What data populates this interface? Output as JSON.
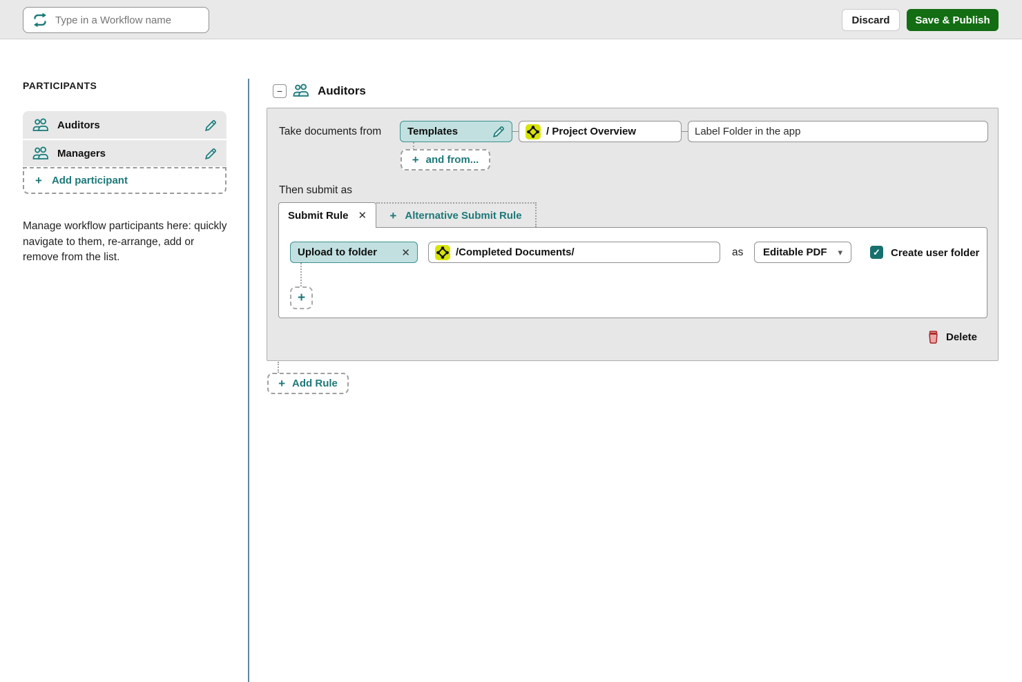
{
  "topbar": {
    "workflow_name_placeholder": "Type in a Workflow name",
    "discard_label": "Discard",
    "save_publish_label": "Save & Publish"
  },
  "sidebar": {
    "heading": "PARTICIPANTS",
    "participants": [
      {
        "label": "Auditors"
      },
      {
        "label": "Managers"
      }
    ],
    "add_participant_label": "Add participant",
    "description": "Manage workflow participants here: quickly navigate to them, re-arrange, add or remove from the list."
  },
  "main": {
    "section_title": "Auditors",
    "take_documents_from_label": "Take documents from",
    "source_chip_label": "Templates",
    "source_folder_path": "/ Project Overview",
    "folder_label_value": "Label Folder in the app",
    "and_from_label": "and from...",
    "then_submit_as_label": "Then submit as",
    "tabs": {
      "active_tab_label": "Submit Rule",
      "alternative_tab_label": "Alternative Submit Rule"
    },
    "rule": {
      "action_chip_label": "Upload to folder",
      "destination_folder_path": "/Completed Documents/",
      "as_label": "as",
      "format_selected": "Editable PDF",
      "create_user_folder_label": "Create user folder",
      "create_user_folder_checked": true,
      "delete_label": "Delete"
    },
    "add_rule_label": "Add Rule"
  },
  "icons": {
    "plus": "+",
    "close": "✕",
    "minus": "−",
    "caret_down": "▾",
    "check": "✓"
  },
  "colors": {
    "teal": "#1e7878",
    "teal_chip_bg": "#c2e0e0",
    "green_button": "#136d13",
    "divider_blue": "#5e87a1",
    "folder_icon_yellow": "#d8e406",
    "delete_red": "#ab2323"
  }
}
